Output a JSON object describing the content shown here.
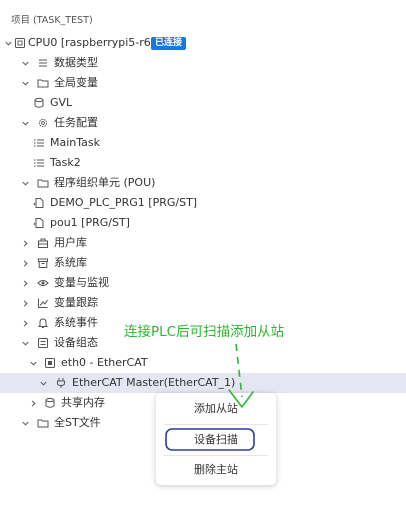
{
  "project": {
    "title": "项目 (TASK_TEST)"
  },
  "tree": {
    "cpu": {
      "label": "CPU0 [raspberrypi5-r6]",
      "status": "已连接"
    },
    "data_types": "数据类型",
    "global_vars": "全局变量",
    "gvl": "GVL",
    "task_config": "任务配置",
    "main_task": "MainTask",
    "task2": "Task2",
    "pou_group": "程序组织单元 (POU)",
    "demo_prg": "DEMO_PLC_PRG1 [PRG/ST]",
    "pou1": "pou1 [PRG/ST]",
    "user_lib": "用户库",
    "system_lib": "系统库",
    "var_monitor": "变量与监视",
    "var_trace": "变量跟踪",
    "system_events": "系统事件",
    "device_config": "设备组态",
    "eth0": "eth0 - EtherCAT",
    "ethercat_master": "EtherCAT Master(EtherCAT_1)",
    "shared_memory": "共享内存",
    "st_files": "全ST文件"
  },
  "context_menu": {
    "add_slave": "添加从站",
    "device_scan": "设备扫描",
    "delete_master": "删除主站"
  },
  "annotation": {
    "text": "连接PLC后可扫描添加从站",
    "color": "#2fb52f"
  },
  "colors": {
    "status_badge": "#1677e6",
    "selected_row": "#e4e6f1"
  }
}
